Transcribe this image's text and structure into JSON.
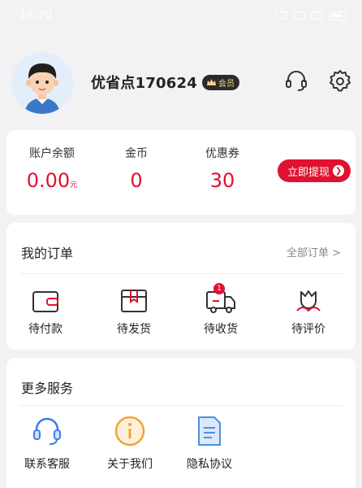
{
  "status_bar": {
    "time": "18:20"
  },
  "profile": {
    "username": "优省点170624",
    "badge": "会员",
    "icons": {
      "customer_service": "headset-icon",
      "settings": "gear-icon"
    }
  },
  "wallet": {
    "balance_label": "账户余额",
    "balance_value": "0.00",
    "balance_unit": "元",
    "coins_label": "金币",
    "coins_value": "0",
    "coupons_label": "优惠券",
    "coupons_value": "30",
    "withdraw_label": "立即提现",
    "accent": "#e0122f"
  },
  "orders": {
    "title": "我的订单",
    "all_link": "全部订单 >",
    "items": [
      {
        "label": "待付款",
        "icon": "wallet-icon"
      },
      {
        "label": "待发货",
        "icon": "package-icon"
      },
      {
        "label": "待收货",
        "icon": "truck-icon",
        "badge": "1"
      },
      {
        "label": "待评价",
        "icon": "flower-icon"
      }
    ]
  },
  "services": {
    "title": "更多服务",
    "items": [
      {
        "label": "联系客服",
        "icon": "headset-icon",
        "color": "#3f7ee8"
      },
      {
        "label": "关于我们",
        "icon": "info-icon",
        "color": "#f2a23a"
      },
      {
        "label": "隐私协议",
        "icon": "document-icon",
        "color": "#4a8fe0"
      }
    ]
  }
}
